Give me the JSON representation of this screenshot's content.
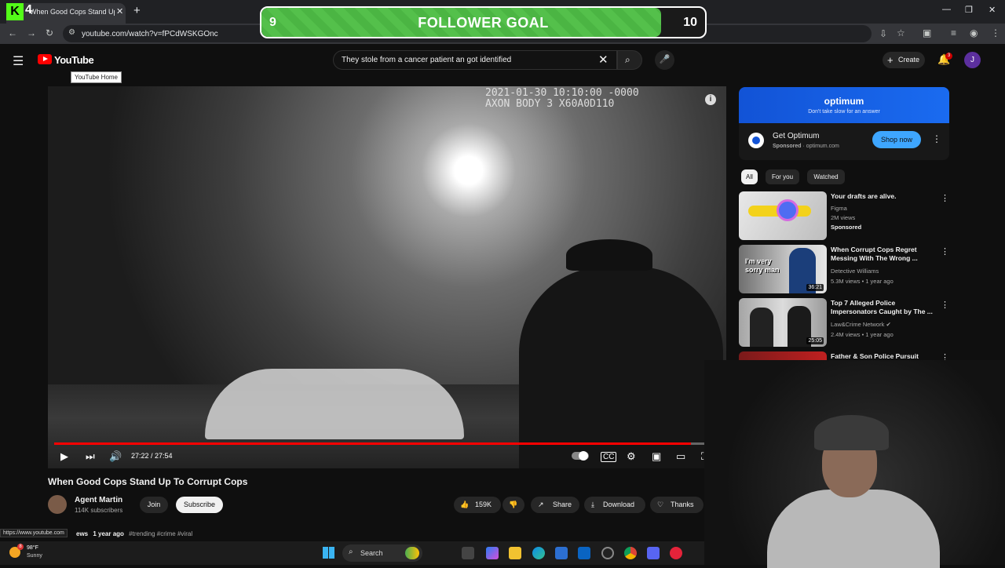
{
  "browser": {
    "tab_title": "When Good Cops Stand Up",
    "url": "youtube.com/watch?v=fPCdWSKGOnc",
    "status_url": "https://www.youtube.com"
  },
  "overlay": {
    "kick_logo": "K",
    "kick_count": "4",
    "goal_current": "9",
    "goal_title": "FOLLOWER GOAL",
    "goal_target": "10",
    "goal_progress": 0.9
  },
  "header": {
    "logo_text": "YouTube",
    "tooltip": "YouTube Home",
    "search_value": "They stole from a cancer patient an got identified",
    "create_label": "Create",
    "notification_count": "3",
    "avatar_initial": "J"
  },
  "video": {
    "watermark": "2021-01-30 10:10:00 -0000\nAXON BODY 3 X60A0D110",
    "time": "27:22 / 27:54",
    "progress": 0.98,
    "title": "When Good Cops Stand Up To Corrupt Cops"
  },
  "channel": {
    "name": "Agent Martin",
    "subscribers": "114K subscribers",
    "join_label": "Join",
    "subscribe_label": "Subscribe"
  },
  "actions": {
    "likes": "159K",
    "share_label": "Share",
    "download_label": "Download",
    "thanks_label": "Thanks"
  },
  "description": {
    "prefix": "ews",
    "age": "1 year ago",
    "tags": "#trending #crime #viral"
  },
  "ad": {
    "brand": "optimum",
    "tagline": "Don't take slow for an answer",
    "title": "Get Optimum",
    "sponsored": "Sponsored",
    "domain": "optimum.com",
    "cta": "Shop now"
  },
  "chips": [
    "All",
    "For you",
    "Watched"
  ],
  "recommendations": [
    {
      "title": "Your drafts are alive.",
      "channel": "Figma",
      "views": "2M views",
      "extra": "Sponsored",
      "duration": "",
      "thumb_text": ""
    },
    {
      "title": "When Corrupt Cops Regret Messing With The Wrong ...",
      "channel": "Detective Williams",
      "views": "5.3M views • 1 year ago",
      "extra": "",
      "duration": "36:21",
      "thumb_text": "I'm very sorry man"
    },
    {
      "title": "Top 7 Alleged Police Impersonators Caught by The ...",
      "channel": "Law&Crime Network",
      "views": "2.4M views • 1 year ago",
      "extra": "",
      "duration": "25:05",
      "thumb_text": ""
    },
    {
      "title": "Father & Son Police Pursuit",
      "channel": "",
      "views": "",
      "extra": "",
      "duration": "",
      "thumb_text": ""
    }
  ],
  "taskbar": {
    "weather_badge": "8",
    "weather_temp": "98°F",
    "weather_desc": "Sunny",
    "search_label": "Search"
  },
  "colors": {
    "youtube_red": "#ff0000",
    "goal_green": "#4bb543",
    "subscribe_bg": "#f1f1f1",
    "ad_blue": "#1253d6"
  }
}
